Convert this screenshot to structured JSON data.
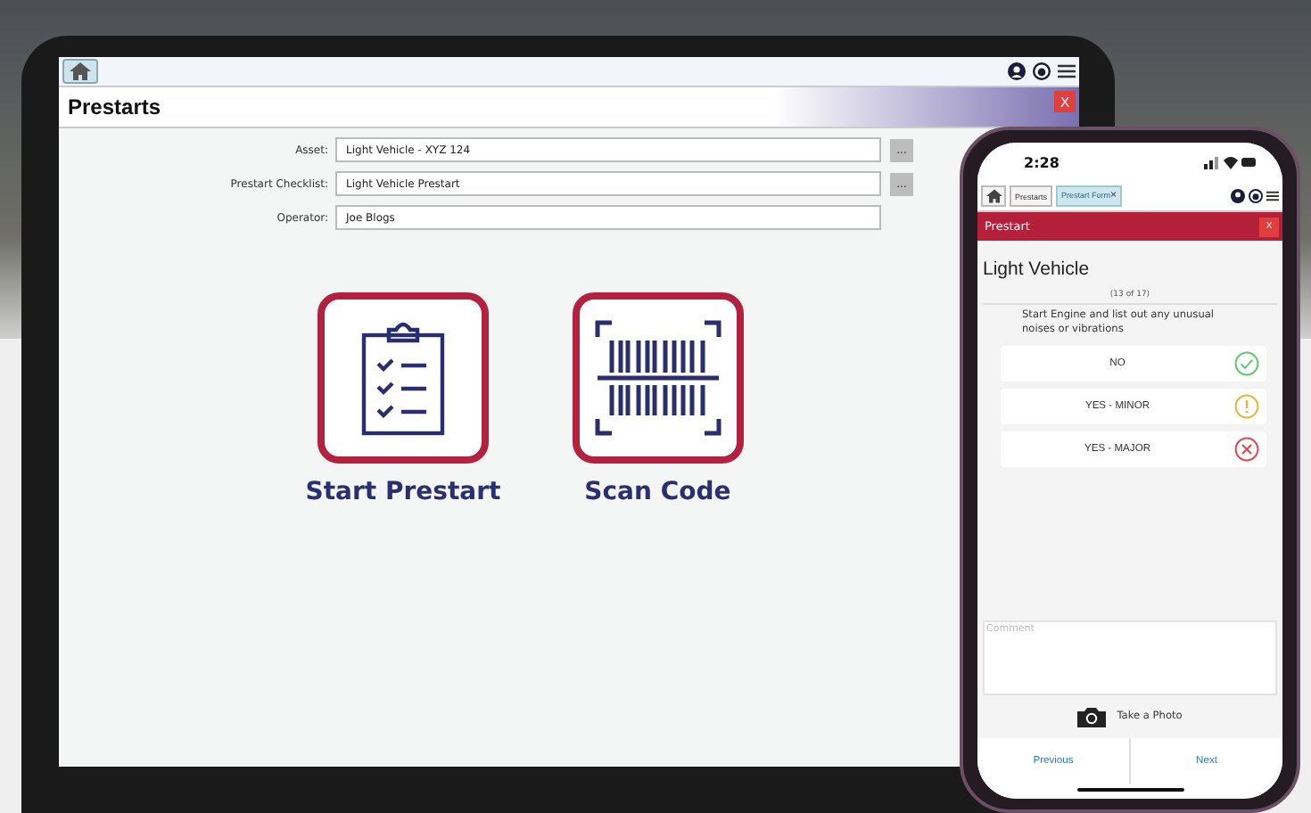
{
  "tablet": {
    "title": "Prestarts",
    "close": "X",
    "fields": [
      {
        "label": "Asset:",
        "value": "Light Vehicle - XYZ 124",
        "lookup": "..."
      },
      {
        "label": "Prestart Checklist:",
        "value": "Light Vehicle Prestart",
        "lookup": "..."
      },
      {
        "label": "Operator:",
        "value": "Joe Blogs"
      }
    ],
    "actions": [
      {
        "kind": "checklist",
        "label": "Start Prestart"
      },
      {
        "kind": "barcode",
        "label": "Scan Code"
      }
    ]
  },
  "phone": {
    "time": "2:28",
    "tabs": [
      {
        "label": "Prestarts",
        "selected": false
      },
      {
        "label": "Prestart Form",
        "selected": true,
        "close": "×"
      }
    ],
    "header": "Prestart",
    "close": "X",
    "title": "Light Vehicle",
    "progress": "(13 of 17)",
    "question": "Start Engine and list out any unusual noises or vibrations",
    "options": [
      {
        "label": "NO",
        "kind": "ok"
      },
      {
        "label": "YES - MINOR",
        "kind": "warning"
      },
      {
        "label": "YES - MAJOR",
        "kind": "error"
      }
    ],
    "comment": {
      "placeholder": "Comment"
    },
    "photo": "Take a Photo",
    "nav": [
      "Previous",
      "Next"
    ]
  }
}
